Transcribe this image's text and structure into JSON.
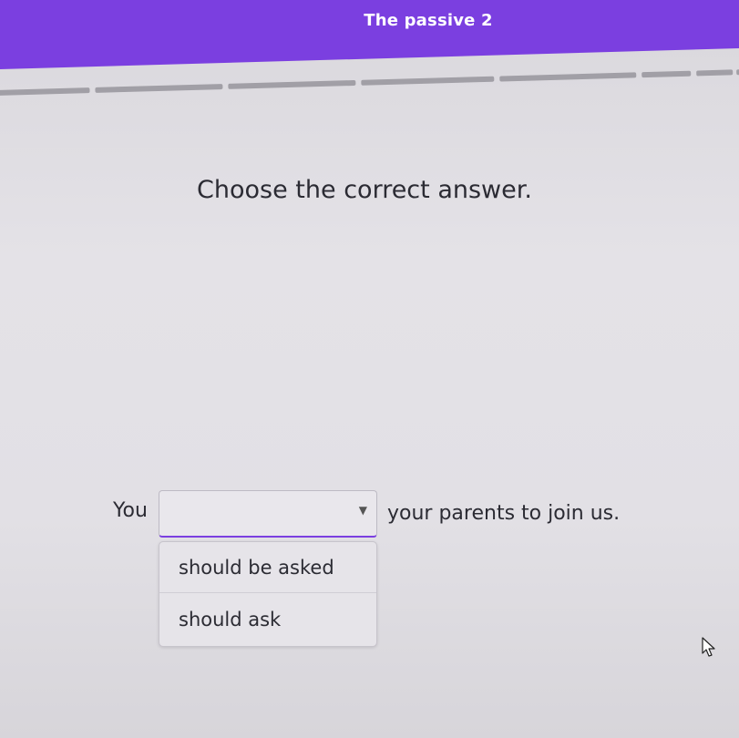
{
  "header": {
    "title": "The passive 2",
    "accent_color": "#7b3fe0"
  },
  "progress": {
    "segment_count": 8
  },
  "question": {
    "prompt": "Choose the correct answer.",
    "before_blank": "You",
    "after_blank": "your parents to join us."
  },
  "dropdown": {
    "selected_value": "",
    "options": [
      "should be asked",
      "should ask"
    ],
    "caret_icon": "chevron-down-icon"
  },
  "pointer": {
    "icon": "mouse-pointer-icon"
  }
}
